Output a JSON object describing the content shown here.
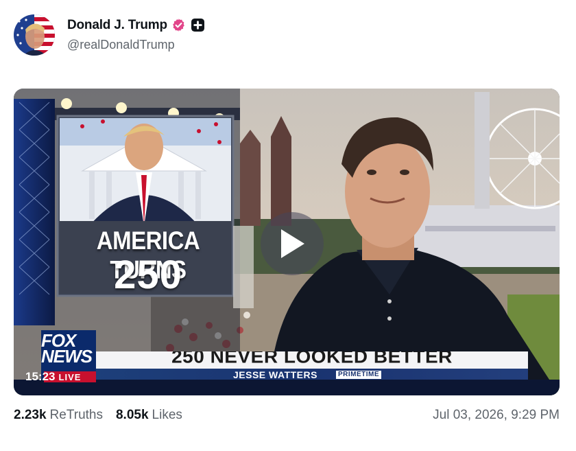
{
  "author": {
    "display_name": "Donald J. Trump",
    "handle": "@realDonaldTrump",
    "verified_icon": "verified-badge-icon",
    "plus_icon": "plus-badge-icon"
  },
  "media": {
    "insert_line1": "AMERICA TURNS",
    "insert_line2": "250",
    "chyron_main": "250 NEVER LOOKED BETTER",
    "chyron_sub": "JESSE WATTERS",
    "chyron_tag": "PRIMETIME",
    "network_logo_line1": "FOX",
    "network_logo_line2": "NEWS",
    "clock": "15:23",
    "live_label": "LIVE",
    "play_icon": "play-icon"
  },
  "stats": {
    "retruths_count": "2.23k",
    "retruths_label": "ReTruths",
    "likes_count": "8.05k",
    "likes_label": "Likes"
  },
  "timestamp": "Jul 03, 2026, 9:29 PM",
  "colors": {
    "verified": "#e2468a",
    "fox_red": "#c8102e",
    "chyron_blue": "#1a3370",
    "muted_text": "#5e646b"
  }
}
